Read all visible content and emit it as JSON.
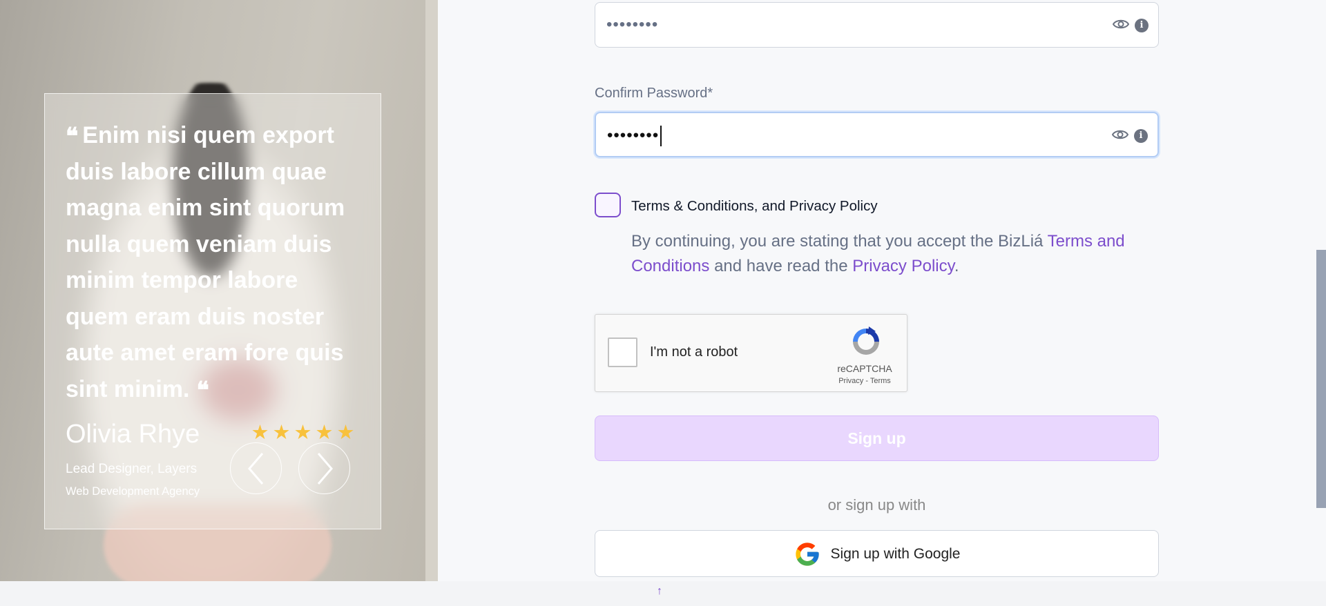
{
  "testimonial": {
    "quote": "Enim nisi quem export duis labore cillum quae magna enim sint quorum nulla quem veniam duis minim tempor labore quem eram duis noster aute amet eram fore quis sint minim.",
    "name": "Olivia Rhye",
    "role": "Lead Designer, Layers",
    "company": "Web Development Agency",
    "rating": 5,
    "icons": {
      "prev": "chevron-left-icon",
      "next": "chevron-right-icon",
      "quote": "quote-icon",
      "star": "star-icon"
    }
  },
  "form": {
    "password": {
      "value": "••••••••",
      "icons": [
        "eye-icon",
        "info-icon"
      ]
    },
    "confirm_password": {
      "label": "Confirm Password*",
      "value": "••••••••",
      "icons": [
        "eye-icon",
        "info-icon"
      ]
    },
    "terms": {
      "title": "Terms & Conditions, and Privacy Policy",
      "prefix": "By continuing, you are stating that you accept the BizLiá ",
      "terms_link": "Terms and Conditions",
      "middle": " and have read the ",
      "privacy_link": "Privacy Policy",
      "suffix": "."
    },
    "captcha": {
      "label": "I'm not a robot",
      "brand": "reCAPTCHA",
      "links": "Privacy - Terms"
    },
    "signup_label": "Sign up",
    "or_text": "or sign up with",
    "google_label": "Sign up with Google"
  },
  "colors": {
    "accent": "#7c4dcc",
    "signup_disabled": "#e9d7fe",
    "star": "#f8c13c",
    "focus": "#b2ccf4"
  }
}
